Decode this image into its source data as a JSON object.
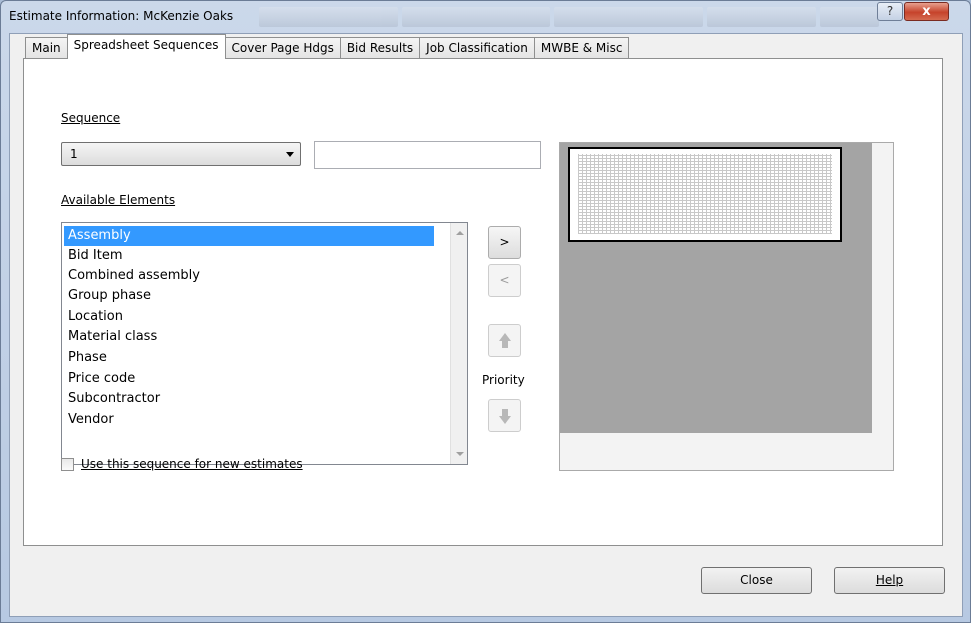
{
  "window": {
    "title": "Estimate Information: McKenzie Oaks",
    "help_glyph": "?",
    "close_glyph": "x"
  },
  "tabs": [
    {
      "label": "Main"
    },
    {
      "label": "Spreadsheet Sequences",
      "active": true
    },
    {
      "label": "Cover Page Hdgs"
    },
    {
      "label": "Bid Results"
    },
    {
      "label": "Job Classification"
    },
    {
      "label": "MWBE & Misc"
    }
  ],
  "sequence": {
    "label": "Sequence",
    "selected": "1",
    "description_value": ""
  },
  "available_elements": {
    "label": "Available Elements",
    "items": [
      "Assembly",
      "Bid Item",
      "Combined assembly",
      "Group phase",
      "Location",
      "Material class",
      "Phase",
      "Price code",
      "Subcontractor",
      "Vendor"
    ],
    "selected_index": 0
  },
  "move_buttons": {
    "add": ">",
    "remove": "<",
    "priority_label": "Priority"
  },
  "checkbox": {
    "label": "Use this sequence for new estimates",
    "checked": false
  },
  "footer": {
    "close": "Close",
    "help": "Help"
  },
  "colors": {
    "selection": "#3399ff",
    "preview_gray": "#a4a4a4"
  }
}
